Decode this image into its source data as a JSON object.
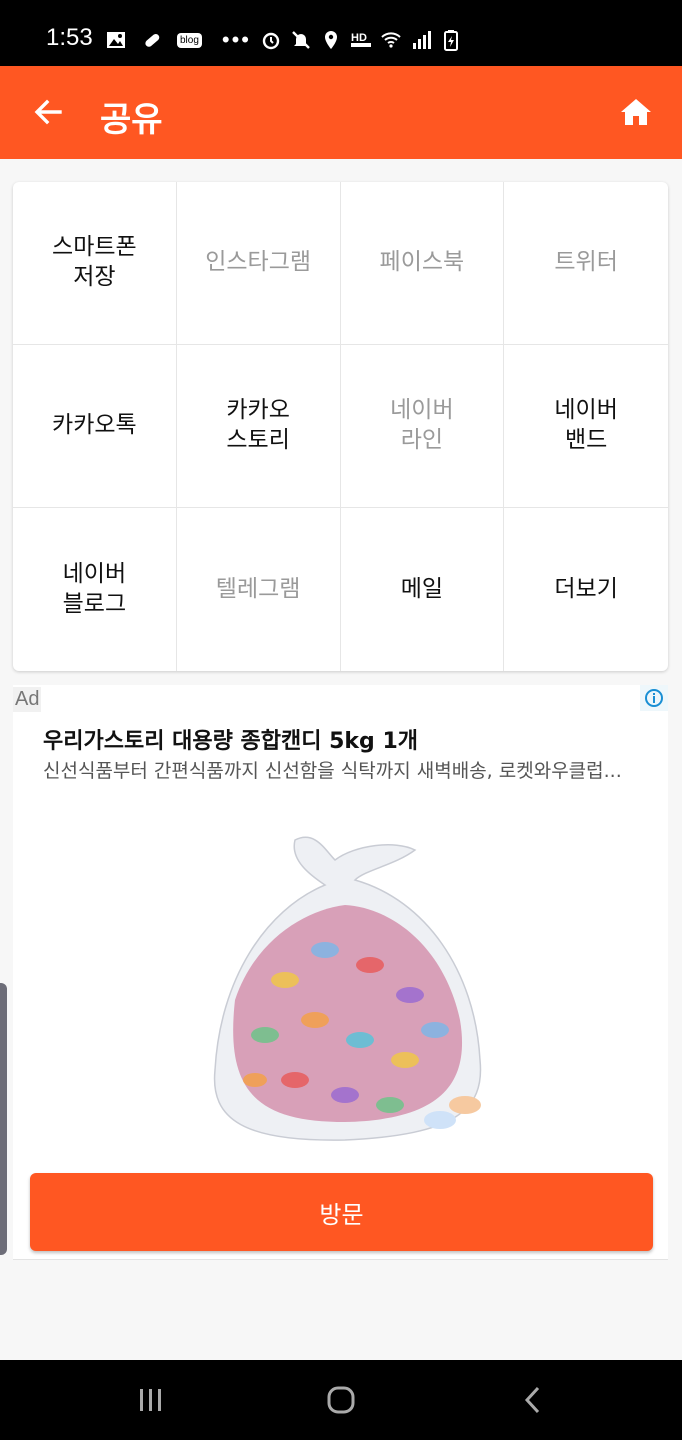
{
  "status_bar": {
    "time": "1:53",
    "blog_tag": "blog",
    "more": "•••",
    "hd_label": "HD",
    "icons": [
      "gallery-icon",
      "pill-icon",
      "blog-icon",
      "alarm-icon",
      "mute-icon",
      "location-icon",
      "hd-voice-icon",
      "wifi-icon",
      "signal-icon",
      "battery-charging-icon"
    ]
  },
  "app_bar": {
    "title": "공유",
    "back_icon": "arrow-left-icon",
    "home_icon": "home-icon"
  },
  "share_grid": [
    {
      "label": "스마트폰\n저장",
      "enabled": true
    },
    {
      "label": "인스타그램",
      "enabled": false
    },
    {
      "label": "페이스북",
      "enabled": false
    },
    {
      "label": "트위터",
      "enabled": false
    },
    {
      "label": "카카오톡",
      "enabled": true
    },
    {
      "label": "카카오\n스토리",
      "enabled": true
    },
    {
      "label": "네이버\n라인",
      "enabled": false
    },
    {
      "label": "네이버\n밴드",
      "enabled": true
    },
    {
      "label": "네이버\n블로그",
      "enabled": true
    },
    {
      "label": "텔레그램",
      "enabled": false
    },
    {
      "label": "메일",
      "enabled": true
    },
    {
      "label": "더보기",
      "enabled": true
    }
  ],
  "ad": {
    "tag": "Ad",
    "headline": "우리가스토리 대용량 종합캔디 5kg 1개",
    "description": "신선식품부터 간편식품까지 신선함을 식탁까지 새벽배송, 로켓와우클럽...",
    "visit_label": "방문"
  },
  "colors": {
    "accent": "#ff5722",
    "enabled_text": "#111111",
    "disabled_text": "#9a9a9a"
  }
}
